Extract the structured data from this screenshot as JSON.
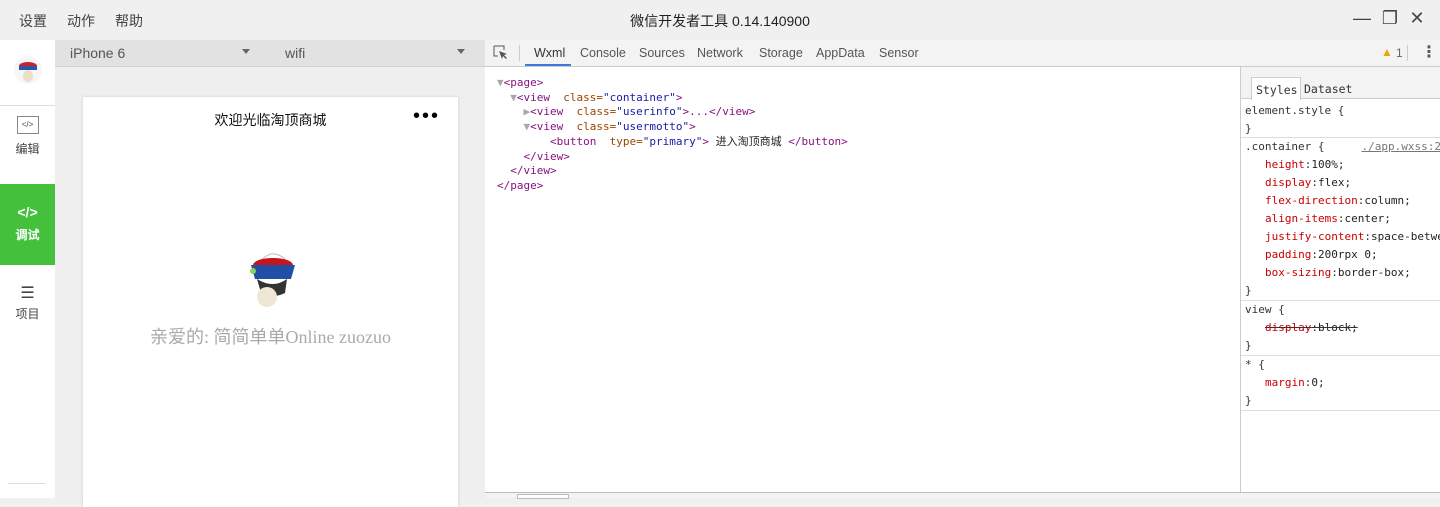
{
  "menu": [
    "设置",
    "动作",
    "帮助"
  ],
  "window_title": "微信开发者工具 0.14.140900",
  "window_controls": {
    "minimize": "—",
    "maximize": "❐",
    "close": "✕"
  },
  "sidebar": {
    "items": [
      {
        "label": "编辑",
        "icon": "</>"
      },
      {
        "label": "调试",
        "icon": "</>"
      },
      {
        "label": "项目",
        "icon": "☰"
      }
    ]
  },
  "simulator": {
    "device": "iPhone 6",
    "network": "wifi",
    "nav_title": "欢迎光临淘顶商城",
    "nav_more": "•••",
    "motto": "亲爱的: 简简单单Online zuozuo"
  },
  "devtools": {
    "tabs": [
      "Wxml",
      "Console",
      "Sources",
      "Network",
      "Storage",
      "AppData",
      "Sensor"
    ],
    "active_tab": "Wxml",
    "warnings": "1",
    "tree": {
      "page_open": "<page>",
      "container_tag": "<view",
      "container_attr": "class=",
      "container_val": "\"container\"",
      "userinfo_tag": "<view",
      "userinfo_attr": "class=",
      "userinfo_val": "\"userinfo\"",
      "userinfo_rest": ">...</view>",
      "usermotto_tag": "<view",
      "usermotto_attr": "class=",
      "usermotto_val": "\"usermotto\"",
      "button_tag": "<button",
      "button_attr": "type=",
      "button_val": "\"primary\"",
      "button_text": "进入淘顶商城",
      "button_close": "</button>",
      "view_close": "</view>",
      "page_close": "</page>"
    },
    "styles": {
      "tabs": [
        "Styles",
        "Dataset"
      ],
      "element_style": "element.style {",
      "container_selector": ".container {",
      "container_source": "./app.wxss:2",
      "container_props": [
        [
          "height",
          "100%;"
        ],
        [
          "display",
          "flex;"
        ],
        [
          "flex-direction",
          "column;"
        ],
        [
          "align-items",
          "center;"
        ],
        [
          "justify-content",
          "space-between;"
        ],
        [
          "padding",
          "200rpx 0;"
        ],
        [
          "box-sizing",
          "border-box;"
        ]
      ],
      "view_selector": "view {",
      "view_prop": [
        "display",
        "block;"
      ],
      "star_selector": "* {",
      "star_prop": [
        "margin",
        "0;"
      ],
      "close": "}"
    }
  },
  "colors": {
    "accent": "#44c03d",
    "tab_underline": "#3879d9"
  }
}
